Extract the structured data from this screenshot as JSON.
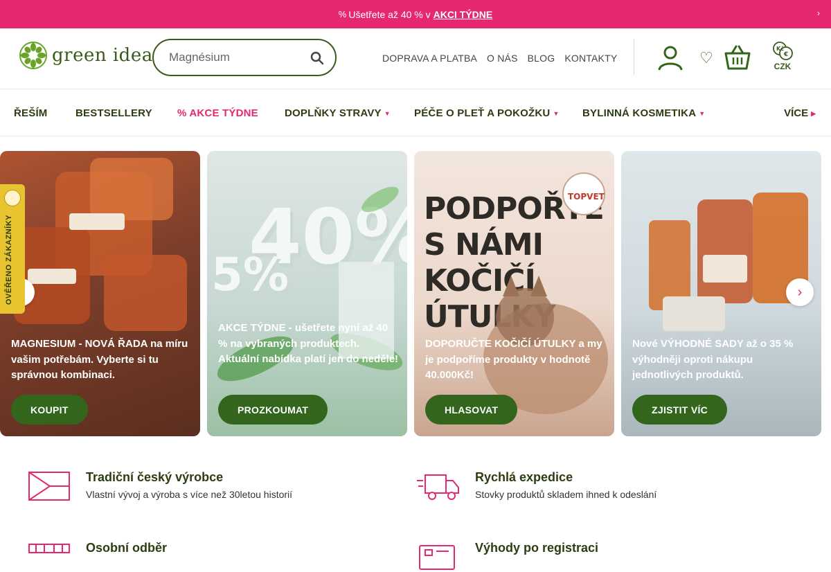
{
  "promo": {
    "icon": "tag-icon",
    "text": "Ušetřete až 40 % v",
    "link": "AKCI TÝDNE",
    "close_glyph": "›"
  },
  "header": {
    "logo_text": "green idea",
    "search": {
      "placeholder": "Magnésium"
    },
    "links": [
      "DOPRAVA A PLATBA",
      "O NÁS",
      "BLOG",
      "KONTAKTY"
    ],
    "currency": "CZK"
  },
  "nav": {
    "items": [
      {
        "label": "ŘEŠÍM"
      },
      {
        "label": "BESTSELLERY"
      },
      {
        "label": "% AKCE TÝDNE"
      },
      {
        "label": "DOPLŇKY STRAVY"
      },
      {
        "label": "PÉČE O PLEŤ A POKOŽKU"
      },
      {
        "label": "BYLINNÁ KOSMETIKA"
      }
    ],
    "more": "VÍCE"
  },
  "banners": [
    {
      "caption": "MAGNESIUM - NOVÁ ŘADA na míru vašim potřebám. Vyberte si tu správnou kombinaci.",
      "cta": "KOUPIT"
    },
    {
      "caption": "AKCE TÝDNE - ušetřete nyní až 40 % na vybraných produktech. Aktuální nabídka platí jen do neděle!",
      "cta": "PROZKOUMAT",
      "big": "40%",
      "small": "5%"
    },
    {
      "caption": "DOPORUČTE KOČIČÍ ÚTULKY a my je podpoříme produkty v hodnotě 40.000Kč!",
      "cta": "HLASOVAT",
      "headline": "PODPOŘTE S NÁMI KOČIČÍ ÚTULKY"
    },
    {
      "caption": "Nové VÝHODNÉ SADY až o 35 % výhodněji oproti nákupu jednotlivých produktů.",
      "cta": "ZJISTIT VÍC"
    }
  ],
  "side_badge": "OVĚŘENO ZÁKAZNÍKY",
  "benefits": [
    {
      "title": "Tradiční český výrobce",
      "desc": "Vlastní vývoj a výroba s více než 30letou historií",
      "icon": "czech-flag-icon"
    },
    {
      "title": "Rychlá expedice",
      "desc": "Stovky produktů skladem ihned k odeslání",
      "icon": "delivery-truck-icon"
    },
    {
      "title": "Osobní odběr",
      "desc": "",
      "icon": "shop-icon"
    },
    {
      "title": "Výhody po registraci",
      "desc": "",
      "icon": "member-card-icon"
    }
  ],
  "colors": {
    "accent": "#e62872",
    "brand_green": "#33651c",
    "badge_yellow": "#e9c431"
  }
}
